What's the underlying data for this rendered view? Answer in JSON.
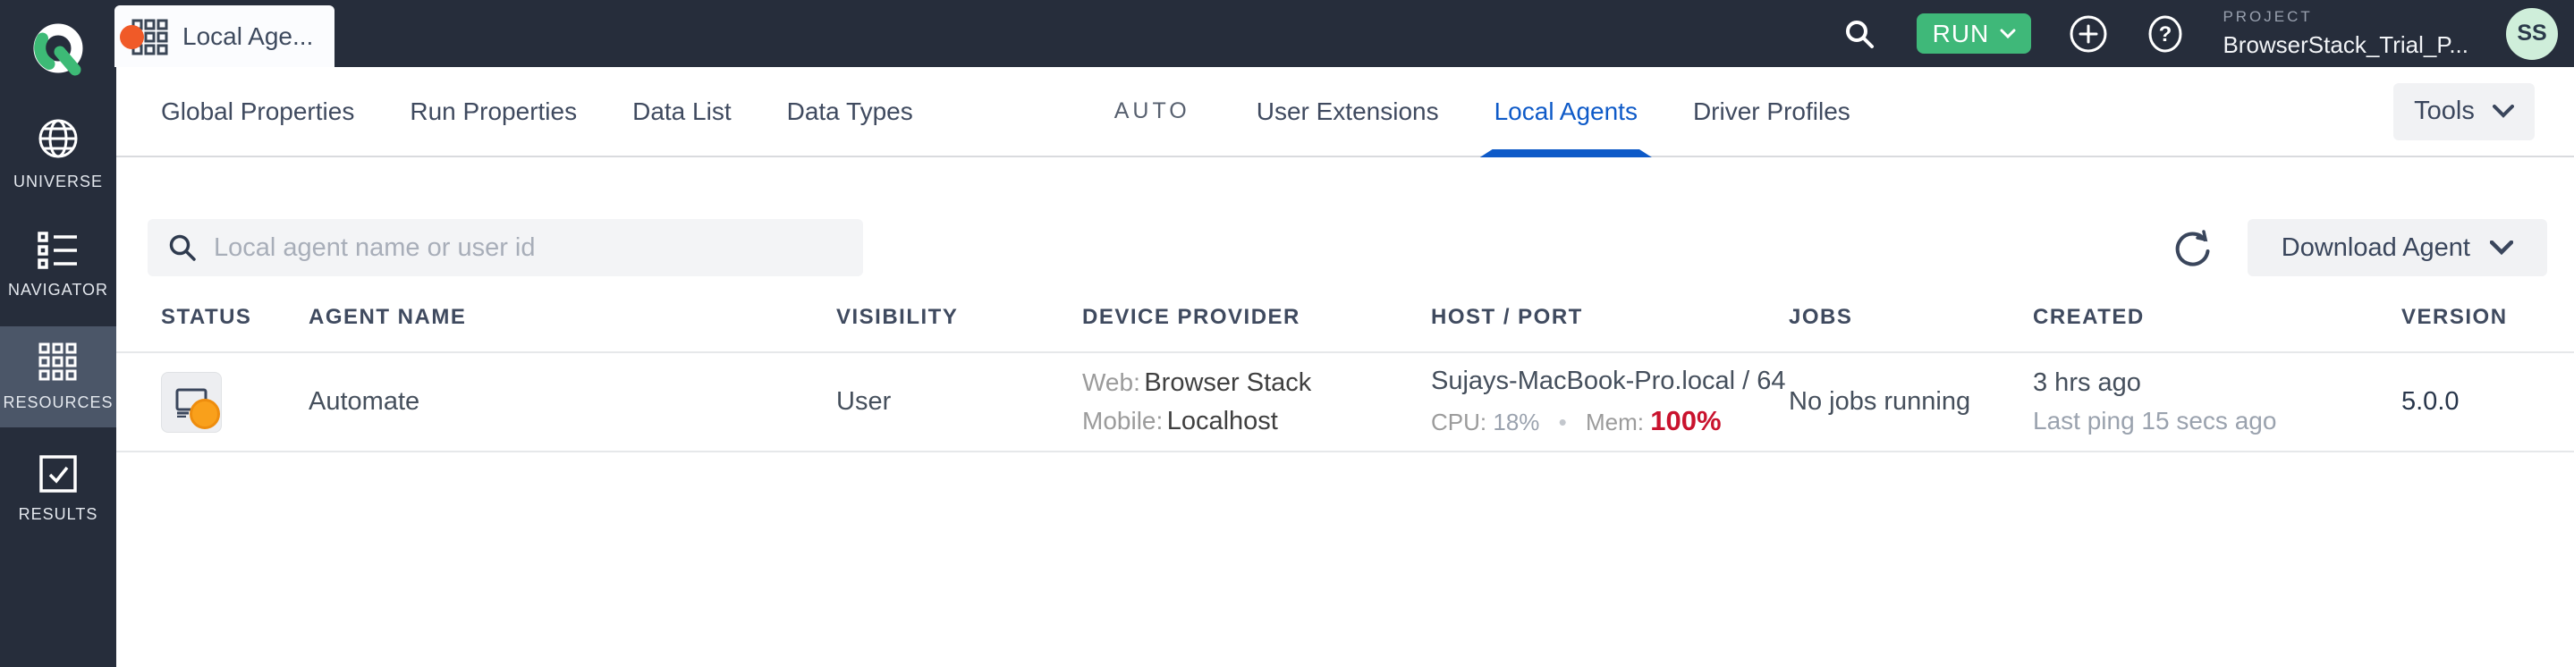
{
  "topbar": {
    "tab_label": "Local Age...",
    "run_label": "RUN",
    "help_glyph": "?",
    "project_label": "PROJECT",
    "project_name": "BrowserStack_Trial_P...",
    "avatar_initials": "SS"
  },
  "sidebar": {
    "items": [
      {
        "label": "UNIVERSE",
        "icon": "globe-icon",
        "active": false
      },
      {
        "label": "NAVIGATOR",
        "icon": "list-icon",
        "active": false
      },
      {
        "label": "RESOURCES",
        "icon": "grid-icon",
        "active": true
      },
      {
        "label": "RESULTS",
        "icon": "checkbox-check-icon",
        "active": false
      }
    ]
  },
  "nav": {
    "tabs_left": [
      "Global Properties",
      "Run Properties",
      "Data List",
      "Data Types"
    ],
    "section_label": "AUTO",
    "tabs_right": [
      "User Extensions",
      "Local Agents",
      "Driver Profiles"
    ],
    "active_tab": "Local Agents",
    "tools_label": "Tools"
  },
  "toolbar": {
    "search_placeholder": "Local agent name or user id",
    "download_label": "Download Agent"
  },
  "table": {
    "headers": [
      "STATUS",
      "AGENT NAME",
      "VISIBILITY",
      "DEVICE PROVIDER",
      "HOST / PORT",
      "JOBS",
      "CREATED",
      "VERSION"
    ],
    "row": {
      "agent_name": "Automate",
      "visibility": "User",
      "web_label": "Web:",
      "web_value": "Browser Stack",
      "mobile_label": "Mobile:",
      "mobile_value": "Localhost",
      "host": "Sujays-MacBook-Pro.local / 64",
      "cpu_label": "CPU:",
      "cpu_value": "18%",
      "mem_label": "Mem:",
      "mem_value": "100%",
      "jobs": "No jobs running",
      "created": "3 hrs ago",
      "last_ping": "Last ping 15 secs ago",
      "version": "5.0.0"
    }
  },
  "icons": {
    "logo": "q-ring-green",
    "tab_icon": "grid-3x3-orange-dot",
    "search": "magnifier",
    "add": "plus-circle",
    "help": "question-circle",
    "refresh": "circular-arrow",
    "chevron": "chevron-down",
    "status": "monitor-orange-dot"
  },
  "colors": {
    "navy": "#262d3b",
    "sidebar_active": "#4b5668",
    "green": "#3fb879",
    "avatar_bg": "#cfeeda",
    "accent_blue": "#0e5ac8",
    "alert_red": "#c9132e",
    "orange": "#f9a01b",
    "tab_orange": "#f05a28"
  }
}
